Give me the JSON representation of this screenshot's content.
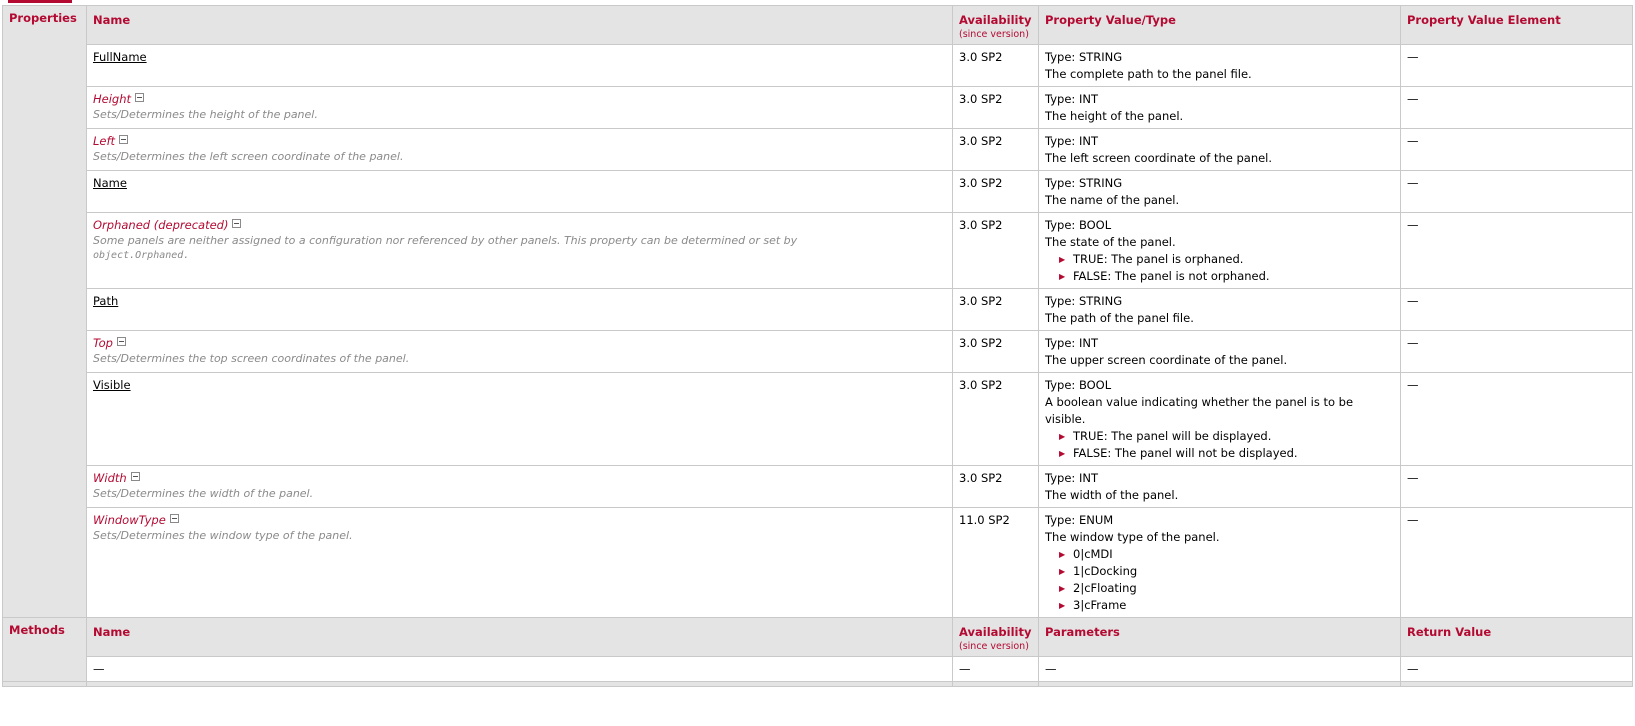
{
  "properties_label": "Properties",
  "prop_headers": {
    "name": "Name",
    "availability": "Availability",
    "since": "(since version)",
    "value": "Property Value/Type",
    "element": "Property Value Element"
  },
  "properties": [
    {
      "name": "FullName",
      "style": "link",
      "desc": "",
      "desc_code": "",
      "avail": "3.0 SP2",
      "type": "Type: STRING",
      "value_desc": "The complete path to the panel file.",
      "items": [],
      "element": "—"
    },
    {
      "name": "Height",
      "style": "red",
      "desc": "Sets/Determines the height of the panel.",
      "desc_code": "",
      "avail": "3.0 SP2",
      "type": "Type: INT",
      "value_desc": "The height of the panel.",
      "items": [],
      "element": "—"
    },
    {
      "name": "Left",
      "style": "red",
      "desc": "Sets/Determines the left screen coordinate of the panel.",
      "desc_code": "",
      "avail": "3.0 SP2",
      "type": "Type: INT",
      "value_desc": "The left screen coordinate of the panel.",
      "items": [],
      "element": "—"
    },
    {
      "name": "Name",
      "style": "link",
      "desc": "",
      "desc_code": "",
      "avail": "3.0 SP2",
      "type": "Type: STRING",
      "value_desc": "The name of the panel.",
      "items": [],
      "element": "—"
    },
    {
      "name": "Orphaned (deprecated)",
      "style": "red",
      "desc": "Some panels are neither assigned to a configuration nor referenced by other panels. This property can be determined or set by",
      "desc_code": "object.Orphaned.",
      "avail": "3.0 SP2",
      "type": "Type: BOOL",
      "value_desc": "The state of the panel.",
      "items": [
        "TRUE: The panel is orphaned.",
        "FALSE: The panel is not orphaned."
      ],
      "element": "—"
    },
    {
      "name": "Path",
      "style": "link",
      "desc": "",
      "desc_code": "",
      "avail": "3.0 SP2",
      "type": "Type: STRING",
      "value_desc": "The path of the panel file.",
      "items": [],
      "element": "—"
    },
    {
      "name": "Top",
      "style": "red",
      "desc": "Sets/Determines the top screen coordinates of the panel.",
      "desc_code": "",
      "avail": "3.0 SP2",
      "type": "Type: INT",
      "value_desc": "The upper screen coordinate of the panel.",
      "items": [],
      "element": "—"
    },
    {
      "name": "Visible",
      "style": "link",
      "desc": "",
      "desc_code": "",
      "avail": "3.0 SP2",
      "type": "Type: BOOL",
      "value_desc": "A boolean value indicating whether the panel is to be visible.",
      "items": [
        "TRUE: The panel will be displayed.",
        "FALSE: The panel will not be displayed."
      ],
      "element": "—"
    },
    {
      "name": "Width",
      "style": "red",
      "desc": "Sets/Determines the width of the panel.",
      "desc_code": "",
      "avail": "3.0 SP2",
      "type": "Type: INT",
      "value_desc": "The width of the panel.",
      "items": [],
      "element": "—"
    },
    {
      "name": "WindowType",
      "style": "red",
      "desc": "Sets/Determines the window type of the panel.",
      "desc_code": "",
      "avail": "11.0 SP2",
      "type": "Type: ENUM",
      "value_desc": "The window type of the panel.",
      "items": [
        "0|cMDI",
        "1|cDocking",
        "2|cFloating",
        "3|cFrame"
      ],
      "element": "—"
    }
  ],
  "methods_label": "Methods",
  "method_headers": {
    "name": "Name",
    "availability": "Availability",
    "since": "(since version)",
    "params": "Parameters",
    "ret": "Return Value"
  },
  "methods": [
    {
      "name": "—",
      "avail": "—",
      "params": "—",
      "ret": "—"
    }
  ]
}
